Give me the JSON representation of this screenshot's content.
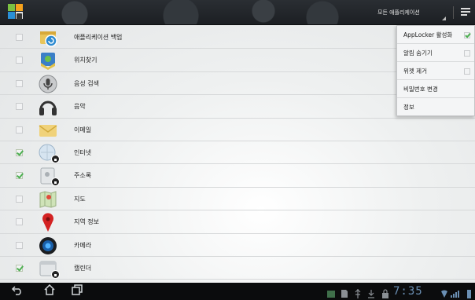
{
  "topbar": {
    "filter_label": "모든 애플리케이션"
  },
  "list": [
    {
      "label": "애플리케이션 백업",
      "checked": false,
      "icon": "backup-icon",
      "locked": false
    },
    {
      "label": "위치찾기",
      "checked": false,
      "icon": "location-finder-icon",
      "locked": false
    },
    {
      "label": "음성 검색",
      "checked": false,
      "icon": "voice-search-icon",
      "locked": false
    },
    {
      "label": "음악",
      "checked": false,
      "icon": "music-icon",
      "locked": false
    },
    {
      "label": "이메일",
      "checked": false,
      "icon": "email-icon",
      "locked": false
    },
    {
      "label": "인터넷",
      "checked": true,
      "icon": "internet-icon",
      "locked": true
    },
    {
      "label": "주소록",
      "checked": true,
      "icon": "contacts-icon",
      "locked": true
    },
    {
      "label": "지도",
      "checked": false,
      "icon": "maps-icon",
      "locked": false
    },
    {
      "label": "지역 정보",
      "checked": false,
      "icon": "places-icon",
      "locked": false
    },
    {
      "label": "카메라",
      "checked": false,
      "icon": "camera-icon",
      "locked": false
    },
    {
      "label": "캘린더",
      "checked": true,
      "icon": "calendar-icon",
      "locked": true
    }
  ],
  "menu": {
    "items": [
      {
        "label": "AppLocker 활성화",
        "checkbox": true,
        "checked": true
      },
      {
        "label": "알림 숨기기",
        "checkbox": true,
        "checked": false
      },
      {
        "label": "위젯 제거",
        "checkbox": true,
        "checked": false
      },
      {
        "label": "비밀번호 변경",
        "checkbox": false,
        "checked": false
      },
      {
        "label": "정보",
        "checkbox": false,
        "checked": false
      }
    ]
  },
  "statusbar": {
    "clock": "7:35"
  },
  "colors": {
    "accent_check": "#4caf50",
    "clock": "#6a8fb3",
    "topbar": "#1c1f23"
  }
}
